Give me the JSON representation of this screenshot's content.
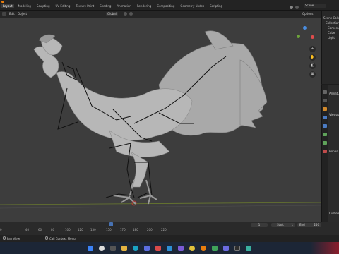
{
  "workspace_tabs": [
    "Layout",
    "Modeling",
    "Sculpting",
    "UV Editing",
    "Texture Paint",
    "Shading",
    "Animation",
    "Rendering",
    "Compositing",
    "Geometry Nodes",
    "Scripting"
  ],
  "scene_label": "Scene",
  "header": {
    "mode": "Edit",
    "object_menu": "Object",
    "orientation": "Global",
    "options": "Options"
  },
  "outliner": {
    "items": [
      "Scene Collection",
      "Collection",
      "Camera",
      "Cube",
      "Light"
    ]
  },
  "properties": {
    "labels": [
      "Armature",
      "Viewport Display",
      "Bones",
      "Custom Props"
    ]
  },
  "timeline": {
    "frame_numbers": [
      "0",
      "40",
      "60",
      "80",
      "100",
      "120",
      "130",
      "150",
      "170",
      "180",
      "200",
      "220"
    ],
    "current_frame": "1",
    "start_label": "Start",
    "start_value": "1",
    "end_label": "End",
    "end_value": "250"
  },
  "statusbar": {
    "left": "Pan View",
    "right": "Call Context Menu"
  },
  "colors": {
    "accent": "#4772b3",
    "viewport": "#3d3d3d",
    "bone": "#111111",
    "axis_red": "#e04c4c",
    "axis_green": "#6da33b",
    "axis_blue": "#4a8de0"
  }
}
